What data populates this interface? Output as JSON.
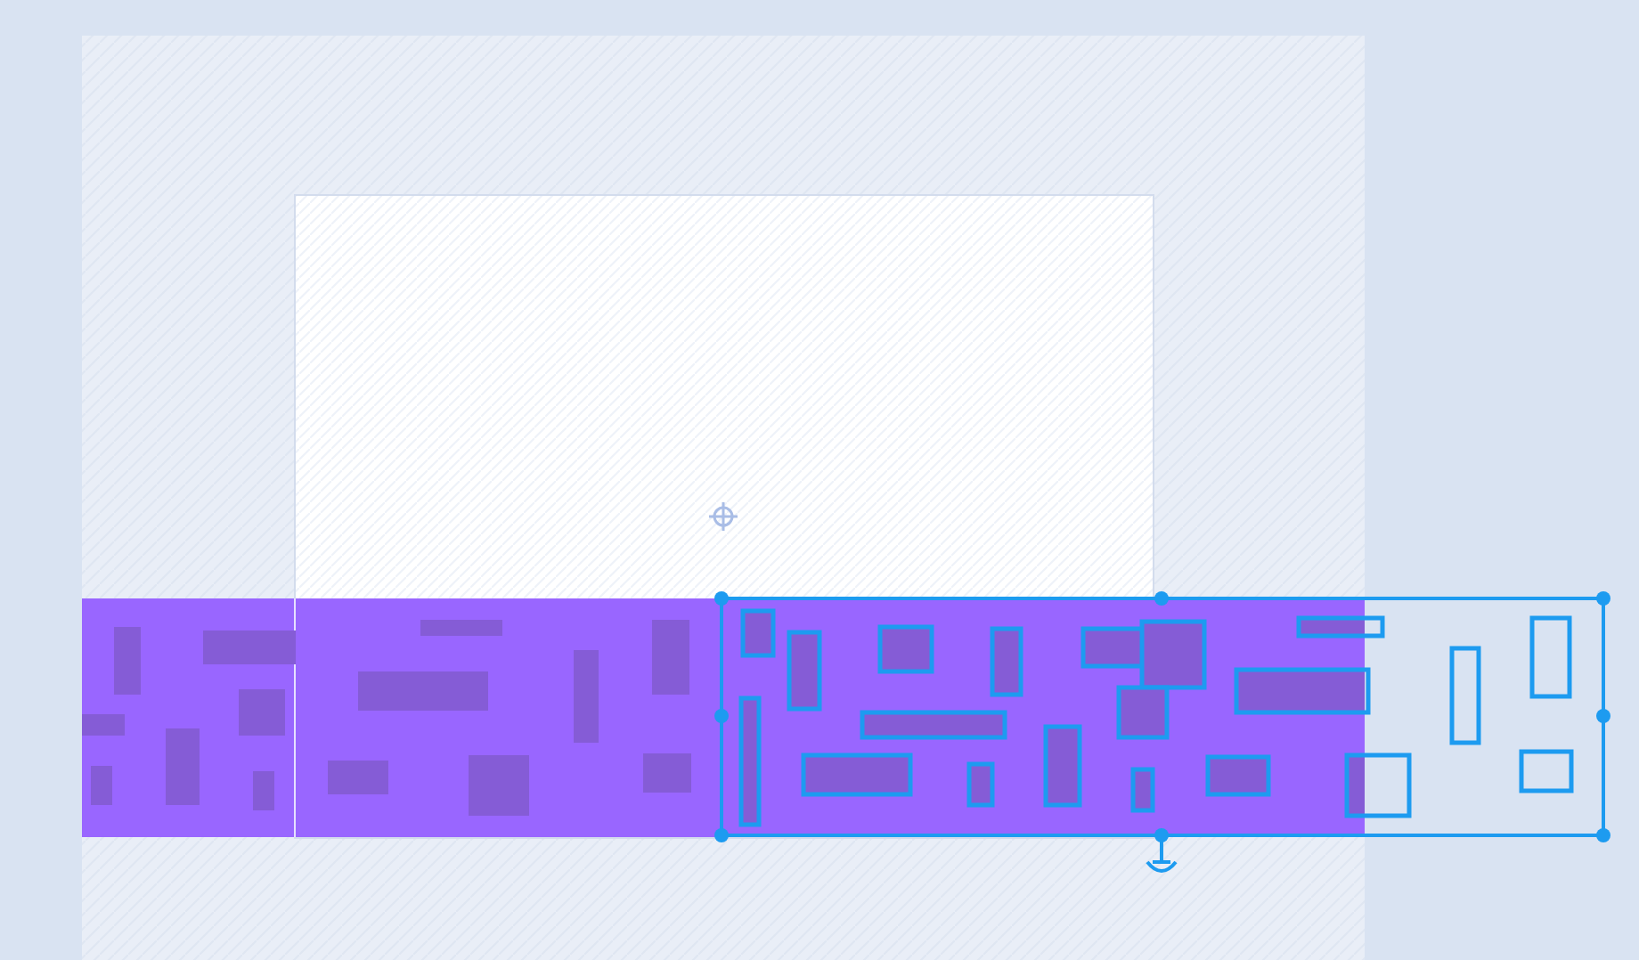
{
  "editor": {
    "shapes": [
      {
        "selected": false
      },
      {
        "selected": false
      },
      {
        "selected": false
      },
      {
        "selected": false
      },
      {
        "selected": false
      },
      {
        "selected": false
      },
      {
        "selected": false
      },
      {
        "selected": false
      },
      {
        "selected": false
      },
      {
        "selected": false
      },
      {
        "selected": false
      },
      {
        "selected": false
      },
      {
        "selected": false
      },
      {
        "selected": false
      },
      {
        "selected": true
      },
      {
        "selected": true
      },
      {
        "selected": true
      },
      {
        "selected": true
      },
      {
        "selected": true
      },
      {
        "selected": true
      },
      {
        "selected": true
      },
      {
        "selected": true
      },
      {
        "selected": true
      },
      {
        "selected": true
      },
      {
        "selected": true
      },
      {
        "selected": true
      },
      {
        "selected": true
      },
      {
        "selected": true
      },
      {
        "selected": true
      },
      {
        "selected": true
      },
      {
        "selected": true
      },
      {
        "selected": true
      },
      {
        "selected": true
      },
      {
        "selected": true
      }
    ]
  }
}
